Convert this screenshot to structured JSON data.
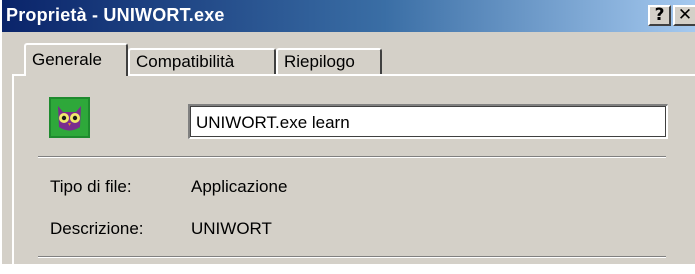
{
  "window": {
    "title": "Proprietà - UNIWORT.exe",
    "help_label": "?",
    "close_label": "✕"
  },
  "tabs": [
    {
      "label": "Generale",
      "active": true
    },
    {
      "label": "Compatibilità",
      "active": false
    },
    {
      "label": "Riepilogo",
      "active": false
    }
  ],
  "general": {
    "icon": "owl-app-icon",
    "file_name": "UNIWORT.exe learn",
    "properties": [
      {
        "label": "Tipo di file:",
        "value": "Applicazione"
      },
      {
        "label": "Descrizione:",
        "value": "UNIWORT"
      }
    ]
  },
  "colors": {
    "titlebar_start": "#0a246a",
    "titlebar_end": "#a6caf0",
    "face": "#d4d0c8"
  }
}
